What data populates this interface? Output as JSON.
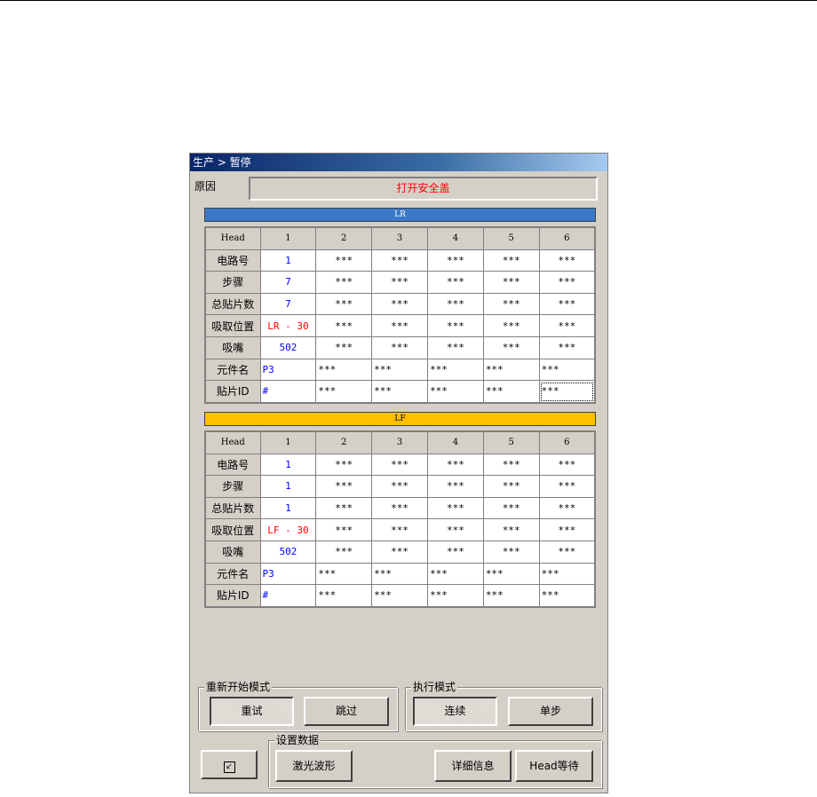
{
  "window": {
    "title": "生产 > 暂停"
  },
  "reason": {
    "label": "原因",
    "value": "打开安全盖"
  },
  "lr": {
    "title": "LR",
    "columns": [
      "Head",
      "1",
      "2",
      "3",
      "4",
      "5",
      "6"
    ],
    "rows": [
      {
        "label": "电路号",
        "values": [
          "1",
          "***",
          "***",
          "***",
          "***",
          "***"
        ]
      },
      {
        "label": "步骤",
        "values": [
          "7",
          "***",
          "***",
          "***",
          "***",
          "***"
        ]
      },
      {
        "label": "总贴片数",
        "values": [
          "7",
          "***",
          "***",
          "***",
          "***",
          "***"
        ]
      },
      {
        "label": "吸取位置",
        "values": [
          "LR - 30",
          "***",
          "***",
          "***",
          "***",
          "***"
        ]
      },
      {
        "label": "吸嘴",
        "values": [
          "502",
          "***",
          "***",
          "***",
          "***",
          "***"
        ]
      },
      {
        "label": "元件名",
        "values": [
          "P3",
          "***",
          "***",
          "***",
          "***",
          "***"
        ]
      },
      {
        "label": "贴片ID",
        "values": [
          "#",
          "***",
          "***",
          "***",
          "***",
          "***"
        ]
      }
    ]
  },
  "lf": {
    "title": "LF",
    "columns": [
      "Head",
      "1",
      "2",
      "3",
      "4",
      "5",
      "6"
    ],
    "rows": [
      {
        "label": "电路号",
        "values": [
          "1",
          "***",
          "***",
          "***",
          "***",
          "***"
        ]
      },
      {
        "label": "步骤",
        "values": [
          "1",
          "***",
          "***",
          "***",
          "***",
          "***"
        ]
      },
      {
        "label": "总贴片数",
        "values": [
          "1",
          "***",
          "***",
          "***",
          "***",
          "***"
        ]
      },
      {
        "label": "吸取位置",
        "values": [
          "LF - 30",
          "***",
          "***",
          "***",
          "***",
          "***"
        ]
      },
      {
        "label": "吸嘴",
        "values": [
          "502",
          "***",
          "***",
          "***",
          "***",
          "***"
        ]
      },
      {
        "label": "元件名",
        "values": [
          "P3",
          "***",
          "***",
          "***",
          "***",
          "***"
        ]
      },
      {
        "label": "贴片ID",
        "values": [
          "#",
          "***",
          "***",
          "***",
          "***",
          "***"
        ]
      }
    ]
  },
  "restart_mode": {
    "title": "重新开始模式",
    "retry": "重试",
    "skip": "跳过"
  },
  "exec_mode": {
    "title": "执行模式",
    "continuous": "连续",
    "step": "单步"
  },
  "settings": {
    "title": "设置数据",
    "laser": "激光波形",
    "details": "详细信息",
    "head_wait": "Head等待"
  },
  "colors": {
    "lr_bar": "#3a78c9",
    "lf_bar": "#ffc000",
    "reason_text": "#ff0000",
    "value_blue": "#0000ff"
  }
}
